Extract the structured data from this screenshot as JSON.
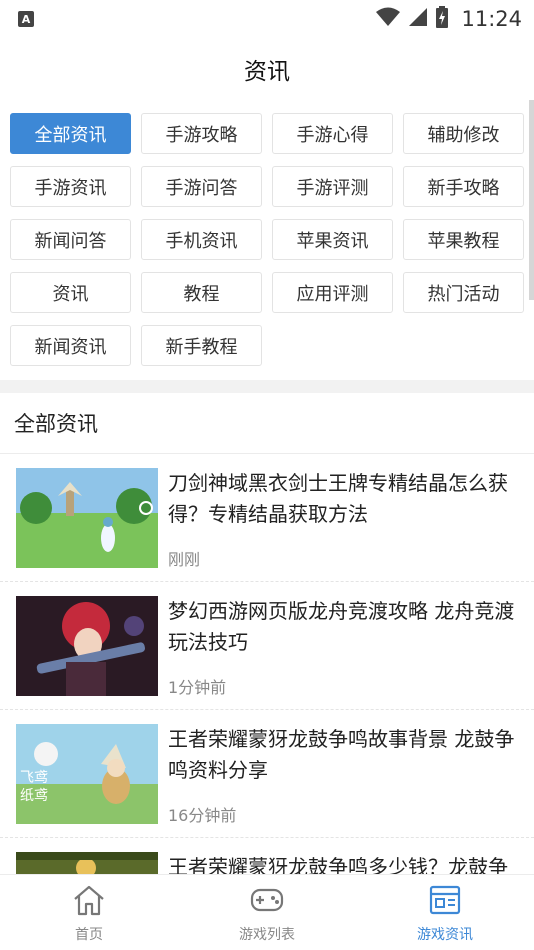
{
  "status_bar": {
    "left_badge": "A",
    "time": "11:24",
    "icons": [
      "wifi-icon",
      "signal-icon",
      "battery-icon"
    ]
  },
  "header": {
    "title": "资讯"
  },
  "categories": [
    "全部资讯",
    "手游攻略",
    "手游心得",
    "辅助修改",
    "手游资讯",
    "手游问答",
    "手游评测",
    "新手攻略",
    "新闻问答",
    "手机资讯",
    "苹果资讯",
    "苹果教程",
    "资讯",
    "教程",
    "应用评测",
    "热门活动",
    "新闻资讯",
    "新手教程"
  ],
  "active_category": "全部资讯",
  "section": {
    "title": "全部资讯"
  },
  "news": [
    {
      "title": "刀剑神域黑衣剑士王牌专精结晶怎么获得？专精结晶获取方法",
      "time": "刚刚"
    },
    {
      "title": "梦幻西游网页版龙舟竞渡攻略 龙舟竞渡玩法技巧",
      "time": "1分钟前"
    },
    {
      "title": "王者荣耀蒙犽龙鼓争鸣故事背景 龙鼓争鸣资料分享",
      "time": "16分钟前"
    },
    {
      "title": "王者荣耀蒙犽龙鼓争鸣多少钱？龙鼓争鸣价格介绍",
      "time": ""
    }
  ],
  "nav": {
    "items": [
      {
        "label": "首页",
        "icon": "home-icon"
      },
      {
        "label": "游戏列表",
        "icon": "gamepad-icon"
      },
      {
        "label": "游戏资讯",
        "icon": "news-icon"
      }
    ],
    "active": "游戏资讯"
  },
  "colors": {
    "accent": "#3d88d6",
    "muted_text": "#888888"
  }
}
